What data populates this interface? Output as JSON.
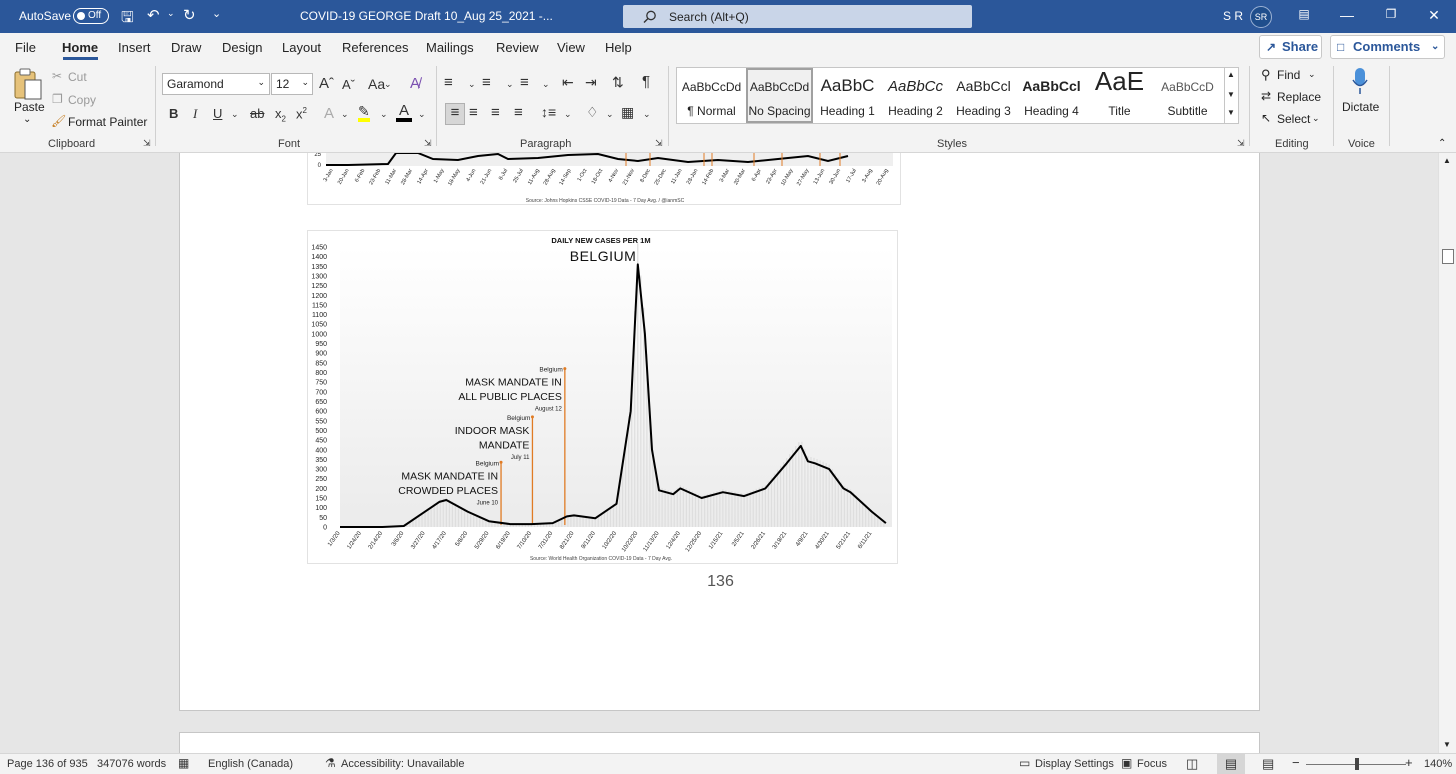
{
  "titlebar": {
    "autosave_label": "AutoSave",
    "autosave_state": "Off",
    "doc_title": "COVID-19 GEORGE Draft 10_Aug 25_2021  -...",
    "search_placeholder": "Search (Alt+Q)",
    "user_name": "S R",
    "user_initials": "SR"
  },
  "menu": {
    "tabs": [
      "File",
      "Home",
      "Insert",
      "Draw",
      "Design",
      "Layout",
      "References",
      "Mailings",
      "Review",
      "View",
      "Help"
    ],
    "active": "Home",
    "share": "Share",
    "comments": "Comments"
  },
  "ribbon": {
    "clipboard": {
      "paste": "Paste",
      "cut": "Cut",
      "copy": "Copy",
      "format_painter": "Format Painter",
      "label": "Clipboard"
    },
    "font": {
      "name": "Garamond",
      "size": "12",
      "label": "Font",
      "case_btn": "Aa"
    },
    "paragraph": {
      "label": "Paragraph"
    },
    "styles": {
      "label": "Styles",
      "items": [
        {
          "preview": "AaBbCcDd",
          "name": "¶ Normal"
        },
        {
          "preview": "AaBbCcDd",
          "name": "No Spacing"
        },
        {
          "preview": "AaBbC",
          "name": "Heading 1"
        },
        {
          "preview": "AaBbCc",
          "name": "Heading 2"
        },
        {
          "preview": "AaBbCcl",
          "name": "Heading 3"
        },
        {
          "preview": "AaBbCcl",
          "name": "Heading 4"
        },
        {
          "preview": "AaE",
          "name": "Title"
        },
        {
          "preview": "AaBbCcD",
          "name": "Subtitle"
        }
      ],
      "selected": "No Spacing"
    },
    "editing": {
      "find": "Find",
      "replace": "Replace",
      "select": "Select",
      "label": "Editing"
    },
    "voice": {
      "dictate": "Dictate",
      "label": "Voice"
    }
  },
  "document": {
    "page_number": "136",
    "top_chart": {
      "y_ticks": [
        "25",
        "0"
      ],
      "x_labels": [
        "3-Jan",
        "20-Jan",
        "6-Feb",
        "23-Feb",
        "11-Mar",
        "28-Mar",
        "14-Apr",
        "1-May",
        "18-May",
        "4-Jun",
        "21-Jun",
        "8-Jul",
        "25-Jul",
        "11-Aug",
        "28-Aug",
        "14-Sep",
        "1-Oct",
        "18-Oct",
        "4-Nov",
        "21-Nov",
        "8-Dec",
        "25-Dec",
        "11-Jan",
        "28-Jan",
        "14-Feb",
        "3-Mar",
        "20-Mar",
        "6-Apr",
        "23-Apr",
        "10-May",
        "27-May",
        "13-Jun",
        "30-Jun",
        "17-Jul",
        "3-Aug",
        "20-Aug"
      ],
      "source": "Source: Johns Hopkins CSSE COVID-19 Data - 7 Day Avg. / @ianmSC"
    }
  },
  "chart_data": {
    "type": "line",
    "title": "BELGIUM",
    "subtitle": "DAILY NEW CASES PER 1M",
    "source": "Source: World Health Organization COVID-19 Data - 7 Day Avg.",
    "ylim": [
      0,
      1450
    ],
    "y_ticks": [
      0,
      50,
      100,
      150,
      200,
      250,
      300,
      350,
      400,
      450,
      500,
      550,
      600,
      650,
      700,
      750,
      800,
      850,
      900,
      950,
      1000,
      1050,
      1100,
      1150,
      1200,
      1250,
      1300,
      1350,
      1400,
      1450
    ],
    "x_ticks": [
      "1/3/20",
      "1/24/20",
      "2/14/20",
      "3/6/20",
      "3/27/20",
      "4/17/20",
      "5/8/20",
      "5/29/20",
      "6/19/20",
      "7/10/20",
      "7/31/20",
      "8/21/20",
      "9/11/20",
      "10/2/20",
      "10/23/20",
      "11/13/20",
      "12/4/20",
      "12/25/20",
      "1/15/21",
      "2/5/21",
      "2/26/21",
      "3/19/21",
      "4/9/21",
      "4/30/21",
      "5/21/21",
      "6/11/21"
    ],
    "series": [
      {
        "x": [
          "1/3/20",
          "1/24/20",
          "2/14/20",
          "3/6/20",
          "3/27/20",
          "4/10/20",
          "4/17/20",
          "5/8/20",
          "5/29/20",
          "6/19/20",
          "7/10/20",
          "7/31/20",
          "8/14/20",
          "8/21/20",
          "9/11/20",
          "10/2/20",
          "10/16/20",
          "10/23/20",
          "10/30/20",
          "11/6/20",
          "11/13/20",
          "11/27/20",
          "12/4/20",
          "12/25/20",
          "1/15/21",
          "2/5/21",
          "2/26/21",
          "3/19/21",
          "4/2/21",
          "4/9/21",
          "4/16/21",
          "4/30/21",
          "5/14/21",
          "5/21/21",
          "6/11/21",
          "6/25/21"
        ],
        "values": [
          0,
          0,
          0,
          5,
          80,
          130,
          140,
          80,
          30,
          15,
          15,
          20,
          55,
          60,
          45,
          120,
          600,
          1360,
          1000,
          400,
          190,
          170,
          200,
          150,
          180,
          160,
          200,
          330,
          420,
          340,
          330,
          300,
          200,
          180,
          80,
          20
        ]
      }
    ],
    "annotations": [
      {
        "place": "Belgium",
        "text": [
          "MASK MANDATE IN",
          "CROWDED PLACES"
        ],
        "date": "June 10",
        "x": "6/10/20",
        "y": 335
      },
      {
        "place": "Belgium",
        "text": [
          "INDOOR MASK",
          "MANDATE"
        ],
        "date": "July 11",
        "x": "7/11/20",
        "y": 570
      },
      {
        "place": "Belgium",
        "text": [
          "MASK MANDATE IN",
          "ALL PUBLIC PLACES"
        ],
        "date": "August 12",
        "x": "8/12/20",
        "y": 820
      }
    ],
    "colors": {
      "line": "#000000",
      "annotation": "#e07b24"
    }
  },
  "statusbar": {
    "page": "Page 136 of 935",
    "words": "347076 words",
    "language": "English (Canada)",
    "accessibility": "Accessibility: Unavailable",
    "display_settings": "Display Settings",
    "focus": "Focus",
    "zoom": "140%"
  }
}
